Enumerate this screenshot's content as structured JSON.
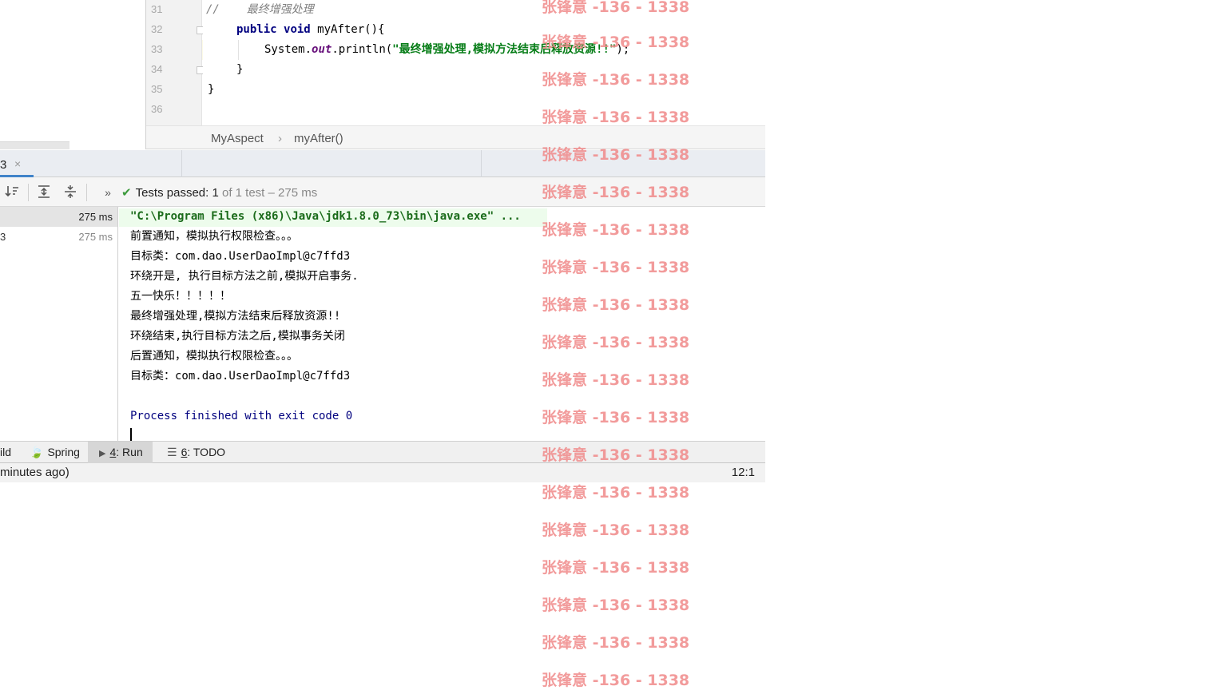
{
  "editor": {
    "lines": [
      {
        "num": "31",
        "comment": "//    最终增强处理"
      },
      {
        "num": "32",
        "kw1": "public",
        "kw2": "void",
        "rest": " myAfter(){"
      },
      {
        "num": "33",
        "pre": "System.",
        "field": "out",
        "mid": ".println(",
        "str": "\"最终增强处理,模拟方法结束后释放资源!!\"",
        "post": ");"
      },
      {
        "num": "34",
        "text": "}"
      },
      {
        "num": "35",
        "text": "}"
      },
      {
        "num": "36",
        "text": ""
      }
    ],
    "breadcrumb": {
      "class_name": "MyAspect",
      "separator": "›",
      "method_name": "myAfter()"
    }
  },
  "run_panel": {
    "tab_label": "3",
    "tab_close": "×",
    "toolbar": {
      "sort_icon": "sort-icon",
      "expand_icon": "expand-all-icon",
      "collapse_icon": "collapse-all-icon",
      "more": "»",
      "check": "✔",
      "status_strong": "Tests passed: 1",
      "status_dim": " of 1 test – 275 ms"
    },
    "test_tree": [
      {
        "label": "",
        "time": "275 ms"
      },
      {
        "label": "3",
        "time": "275 ms"
      }
    ],
    "console": {
      "command": "\"C:\\Program Files (x86)\\Java\\jdk1.8.0_73\\bin\\java.exe\" ...",
      "lines": [
        "前置通知，模拟执行权限检查。。。",
        "目标类：com.dao.UserDaoImpl@c7ffd3",
        "环绕开是, 执行目标方法之前,模拟开启事务.",
        "五一快乐！！！！！",
        "最终增强处理,模拟方法结束后释放资源!!",
        "环绕结束,执行目标方法之后,模拟事务关闭",
        "后置通知，模拟执行权限检查。。。",
        "目标类：com.dao.UserDaoImpl@c7ffd3"
      ],
      "exit": "Process finished with exit code 0"
    }
  },
  "toolwindow_bar": {
    "build": "ild",
    "spring": "Spring",
    "run_num": "4",
    "run_label": ": Run",
    "todo_num": "6",
    "todo_label": ": TODO"
  },
  "status_bar": {
    "left": "minutes ago)",
    "position": "12:1"
  },
  "watermark": "张锋意 -136 - 1338"
}
